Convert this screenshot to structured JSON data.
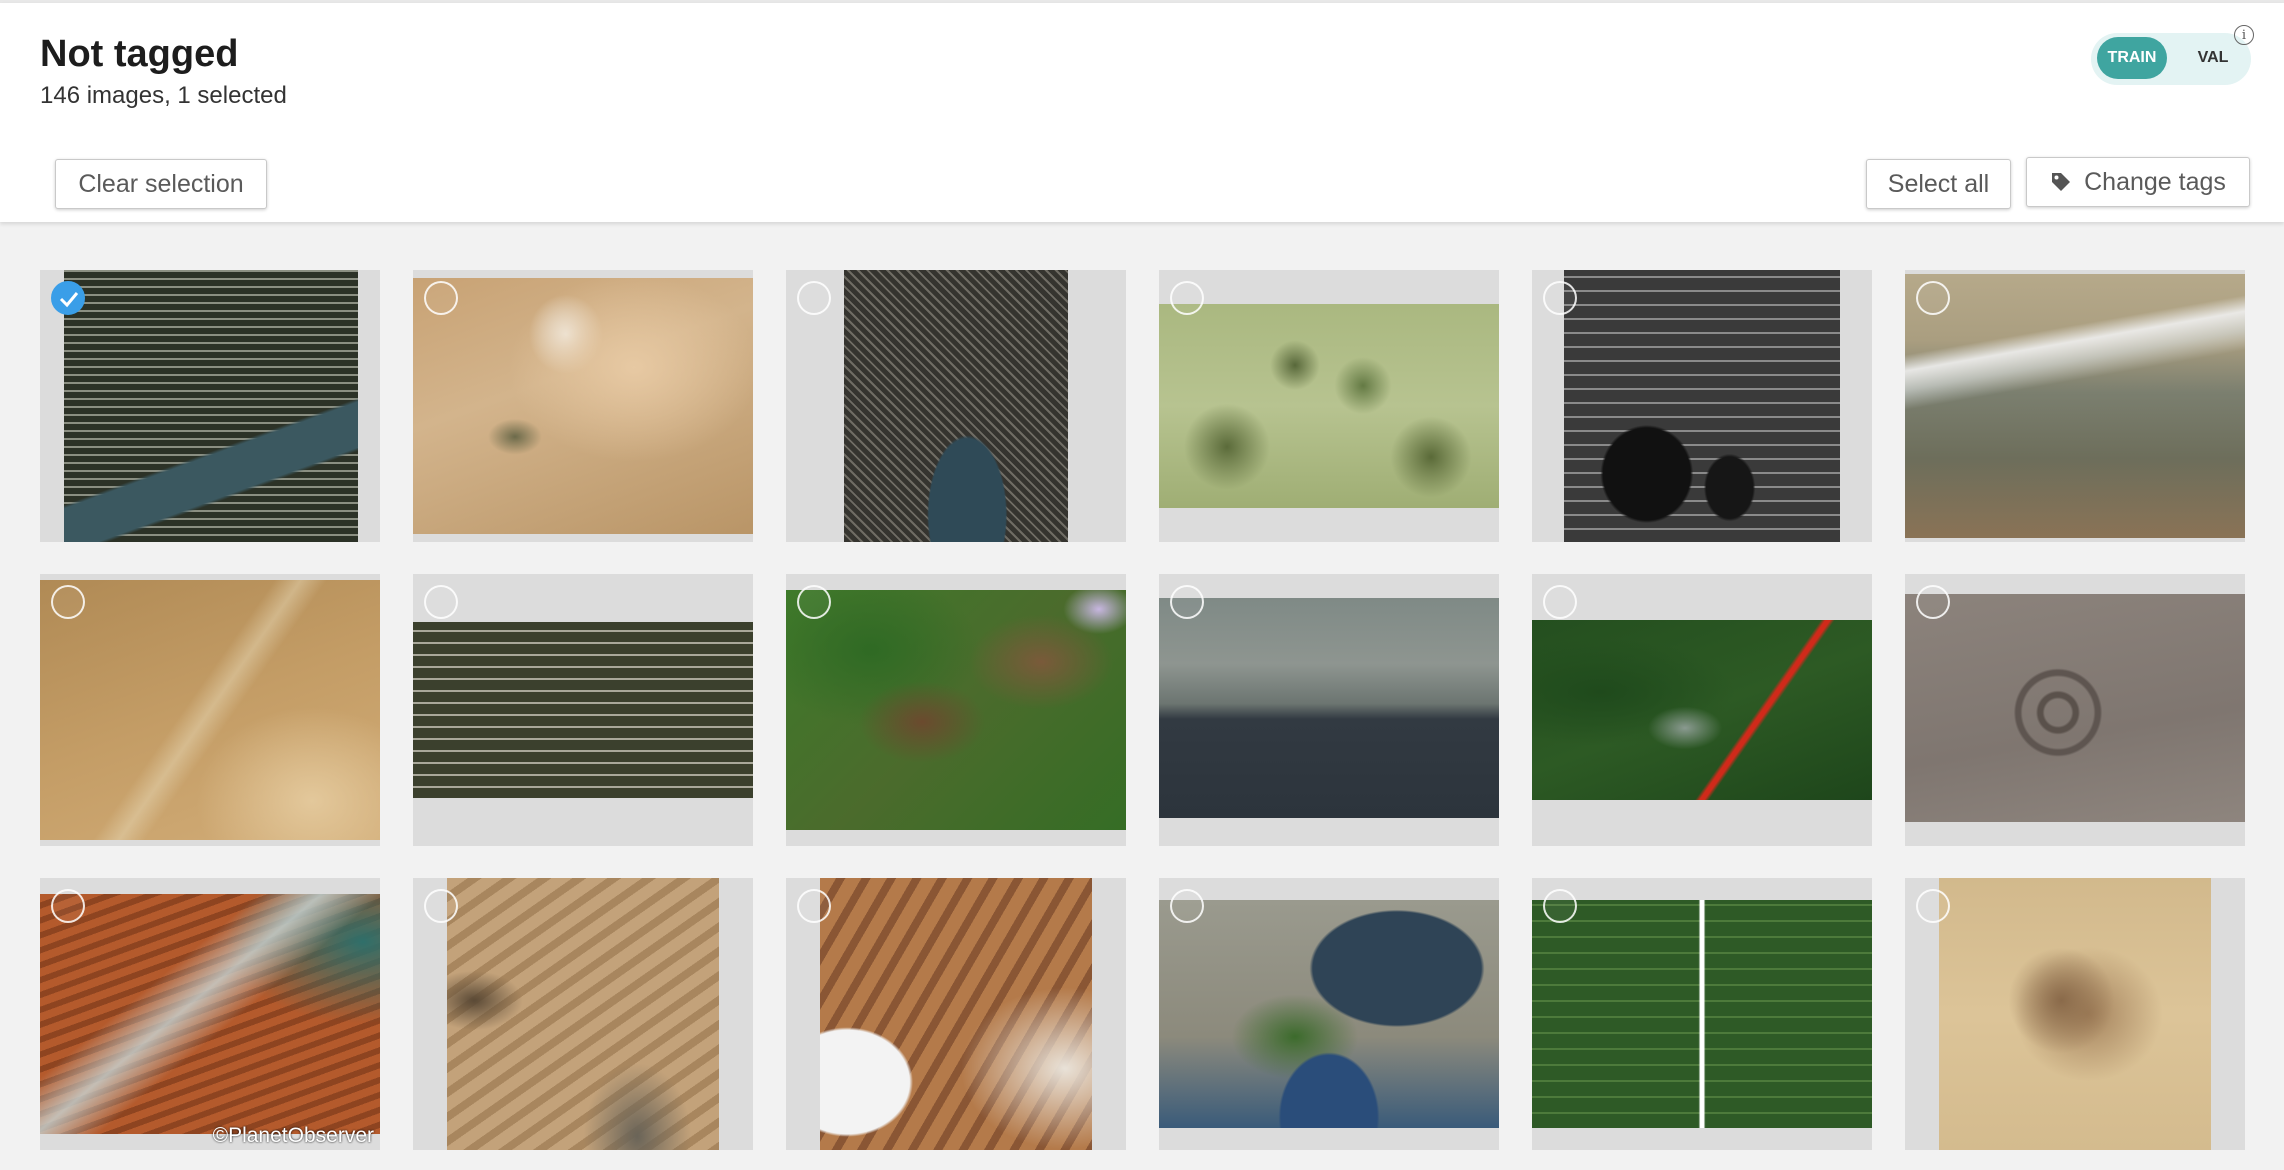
{
  "header": {
    "title": "Not tagged",
    "count_text": "146 images, 1 selected",
    "clear_label": "Clear selection",
    "select_all_label": "Select all",
    "change_tags_label": "Change tags",
    "toggle": {
      "train": "TRAIN",
      "val": "VAL",
      "active": "TRAIN"
    },
    "info_glyph": "i"
  },
  "colors": {
    "accent": "#3fa5a0",
    "selected": "#3a9ee8"
  },
  "grid": {
    "tiles": [
      {
        "id": "tile-1",
        "selected": true,
        "scene": "dense-city-river"
      },
      {
        "id": "tile-2",
        "selected": false,
        "scene": "sandy-desert"
      },
      {
        "id": "tile-3",
        "selected": false,
        "scene": "city-lake"
      },
      {
        "id": "tile-4",
        "selected": false,
        "scene": "green-hills"
      },
      {
        "id": "tile-5",
        "selected": false,
        "scene": "grayscale-city"
      },
      {
        "id": "tile-6",
        "selected": false,
        "scene": "snowy-mountains"
      },
      {
        "id": "tile-7",
        "selected": false,
        "scene": "desert-compound"
      },
      {
        "id": "tile-8",
        "selected": false,
        "scene": "city-blocks"
      },
      {
        "id": "tile-9",
        "selected": false,
        "scene": "green-mountains"
      },
      {
        "id": "tile-10",
        "selected": false,
        "scene": "coastal-town"
      },
      {
        "id": "tile-11",
        "selected": false,
        "scene": "forest-red-line"
      },
      {
        "id": "tile-12",
        "selected": false,
        "scene": "gray-desert-circle"
      },
      {
        "id": "tile-13",
        "selected": false,
        "scene": "red-dunes-water",
        "watermark": "©PlanetObserver"
      },
      {
        "id": "tile-14",
        "selected": false,
        "scene": "brown-dunes"
      },
      {
        "id": "tile-15",
        "selected": false,
        "scene": "orange-dunes"
      },
      {
        "id": "tile-16",
        "selected": false,
        "scene": "coastal-city-bay"
      },
      {
        "id": "tile-17",
        "selected": false,
        "scene": "forest-comparison"
      },
      {
        "id": "tile-18",
        "selected": false,
        "scene": "pale-desert"
      }
    ]
  }
}
